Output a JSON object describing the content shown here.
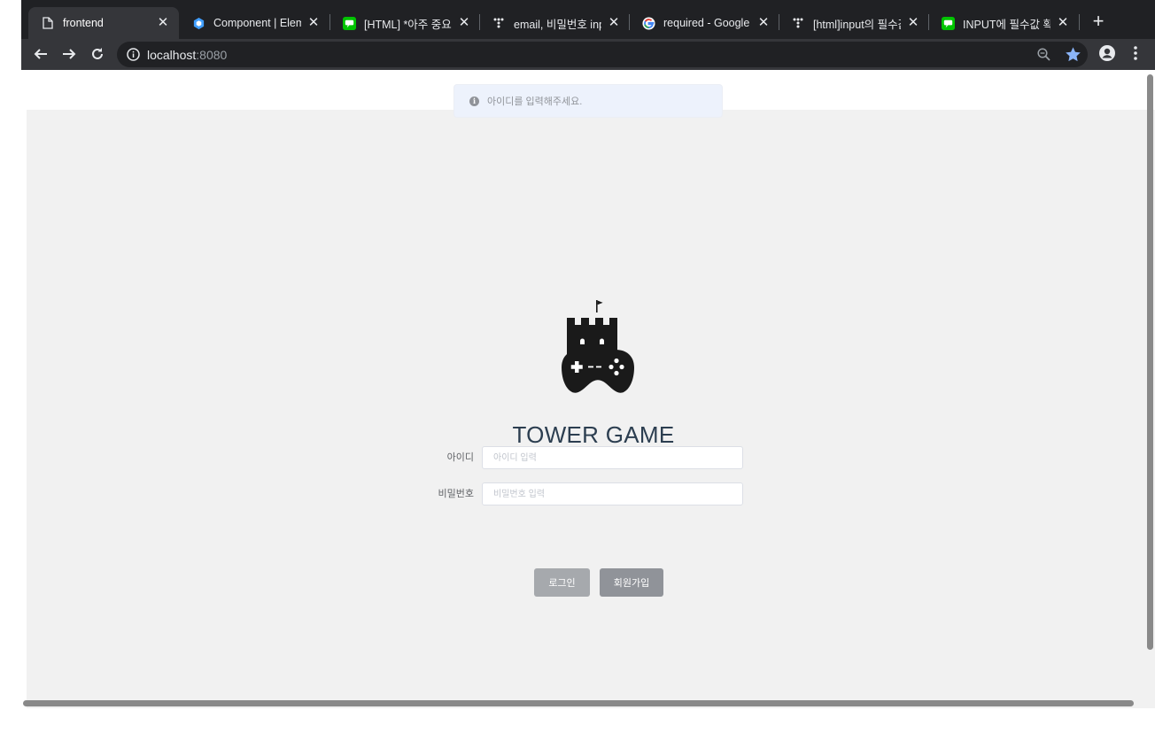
{
  "browser": {
    "tabs": [
      {
        "title": "frontend",
        "icon": "page-icon",
        "active": true
      },
      {
        "title": "Component | Elem",
        "icon": "element-ui-icon",
        "active": false
      },
      {
        "title": "[HTML] *아주 중요*",
        "icon": "line-icon",
        "active": false
      },
      {
        "title": "email, 비밀번호 inpu",
        "icon": "tistory-icon",
        "active": false
      },
      {
        "title": "required - Google",
        "icon": "google-icon",
        "active": false
      },
      {
        "title": "[html]input의 필수값",
        "icon": "tistory-icon",
        "active": false
      },
      {
        "title": "INPUT에 필수값 확인",
        "icon": "line-icon",
        "active": false
      }
    ],
    "address": {
      "host": "localhost",
      "port": ":8080"
    }
  },
  "toast": {
    "message": "아이디를 입력해주세요.",
    "icon": "info-icon"
  },
  "brand": {
    "title": "TOWER GAME"
  },
  "form": {
    "username": {
      "label": "아이디",
      "placeholder": "아이디 입력",
      "value": ""
    },
    "password": {
      "label": "비밀번호",
      "placeholder": "비밀번호 입력",
      "value": ""
    }
  },
  "buttons": {
    "login": "로그인",
    "signup": "회원가입"
  },
  "colors": {
    "title": "#2c3e50",
    "toast_bg": "#edf2fc",
    "button_login": "#a6a9ad",
    "button_signup": "#909399"
  }
}
